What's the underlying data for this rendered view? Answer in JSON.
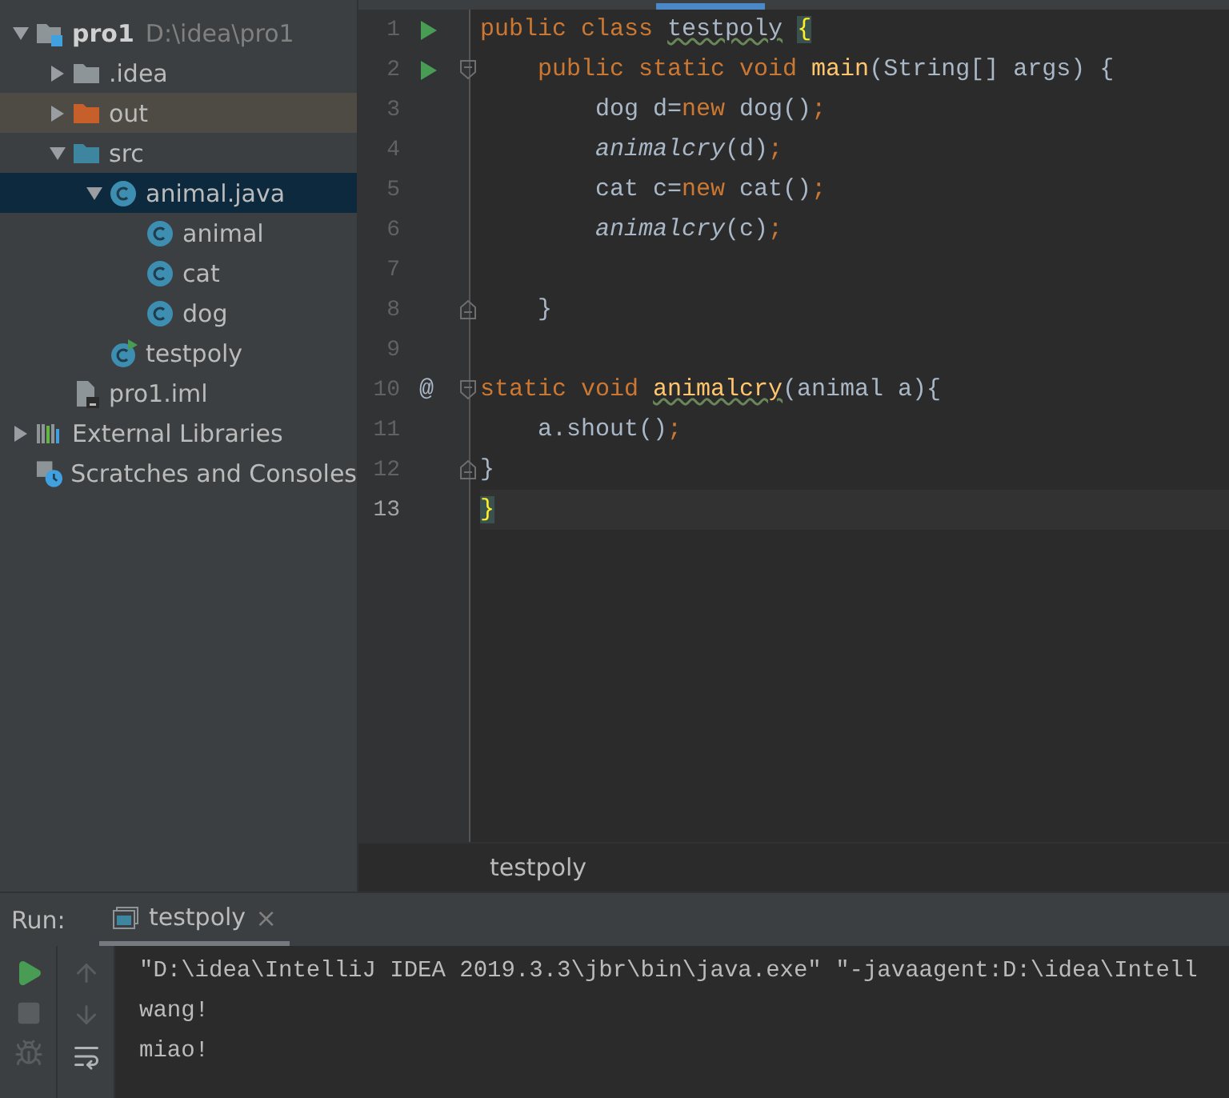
{
  "project_tree": [
    {
      "label": "pro1",
      "path": "D:\\idea\\pro1",
      "kind": "module",
      "expanded": true,
      "selected": false,
      "children": [
        {
          "label": ".idea",
          "kind": "folder",
          "expanded": false,
          "selected": false
        },
        {
          "label": "out",
          "kind": "excluded-folder",
          "expanded": false,
          "selected": false
        },
        {
          "label": "src",
          "kind": "source-folder",
          "expanded": true,
          "selected": false,
          "children": [
            {
              "label": "animal.java",
              "kind": "class",
              "expanded": true,
              "selected": true,
              "children": [
                {
                  "label": "animal",
                  "kind": "class",
                  "selected": false
                },
                {
                  "label": "cat",
                  "kind": "class",
                  "selected": false
                },
                {
                  "label": "dog",
                  "kind": "class",
                  "selected": false
                }
              ]
            },
            {
              "label": "testpoly",
              "kind": "runnable-class",
              "selected": false
            }
          ]
        },
        {
          "label": "pro1.iml",
          "kind": "file",
          "selected": false
        }
      ]
    },
    {
      "label": "External Libraries",
      "kind": "library",
      "expanded": false,
      "selected": false
    },
    {
      "label": "Scratches and Consoles",
      "kind": "scratches",
      "selected": false
    }
  ],
  "editor": {
    "lines": [
      {
        "number": "1",
        "run": true,
        "fold_start": false,
        "fold_end": false,
        "current": false,
        "tokens": [
          {
            "kind": "keyword",
            "text": "public class "
          },
          {
            "kind": "warn",
            "text": "testpoly"
          },
          {
            "kind": "match",
            "text": " {"
          }
        ]
      },
      {
        "number": "2",
        "run": true,
        "fold_start": true,
        "fold_end": false,
        "current": false,
        "tokens": [
          {
            "kind": "keyword",
            "text": "    public static void "
          },
          {
            "kind": "decl",
            "text": "main"
          },
          {
            "kind": "plain",
            "text": "(String[] args) {"
          }
        ]
      },
      {
        "number": "3",
        "run": false,
        "fold_start": false,
        "fold_end": false,
        "current": false,
        "tokens": [
          {
            "kind": "plain",
            "text": "        dog d="
          },
          {
            "kind": "keyword",
            "text": "new"
          },
          {
            "kind": "plain",
            "text": " dog()"
          },
          {
            "kind": "punct",
            "text": ";"
          }
        ]
      },
      {
        "number": "4",
        "run": false,
        "fold_start": false,
        "fold_end": false,
        "current": false,
        "tokens": [
          {
            "kind": "call",
            "text": "        animalcry"
          },
          {
            "kind": "plain",
            "text": "(d)"
          },
          {
            "kind": "punct",
            "text": ";"
          }
        ]
      },
      {
        "number": "5",
        "run": false,
        "fold_start": false,
        "fold_end": false,
        "current": false,
        "tokens": [
          {
            "kind": "plain",
            "text": "        cat c="
          },
          {
            "kind": "keyword",
            "text": "new"
          },
          {
            "kind": "plain",
            "text": " cat()"
          },
          {
            "kind": "punct",
            "text": ";"
          }
        ]
      },
      {
        "number": "6",
        "run": false,
        "fold_start": false,
        "fold_end": false,
        "current": false,
        "tokens": [
          {
            "kind": "call",
            "text": "        animalcry"
          },
          {
            "kind": "plain",
            "text": "(c)"
          },
          {
            "kind": "punct",
            "text": ";"
          }
        ]
      },
      {
        "number": "7",
        "run": false,
        "fold_start": false,
        "fold_end": false,
        "current": false
      },
      {
        "number": "8",
        "run": false,
        "fold_start": false,
        "fold_end": true,
        "current": false,
        "tokens": [
          {
            "kind": "plain",
            "text": "    }"
          }
        ]
      },
      {
        "number": "9",
        "run": false,
        "fold_start": false,
        "fold_end": false,
        "current": false
      },
      {
        "number": "10",
        "gutter_mark": "@",
        "run": false,
        "fold_start": true,
        "fold_end": false,
        "current": false,
        "tokens": [
          {
            "kind": "keyword",
            "text": "static void "
          },
          {
            "kind": "decl-warn",
            "text": "animalcry"
          },
          {
            "kind": "plain",
            "text": "(animal a){"
          }
        ]
      },
      {
        "number": "11",
        "run": false,
        "fold_start": false,
        "fold_end": false,
        "current": false,
        "tokens": [
          {
            "kind": "plain",
            "text": "    a.shout()"
          },
          {
            "kind": "punct",
            "text": ";"
          }
        ]
      },
      {
        "number": "12",
        "run": false,
        "fold_start": false,
        "fold_end": true,
        "current": false,
        "tokens": [
          {
            "kind": "plain",
            "text": "}"
          }
        ]
      },
      {
        "number": "13",
        "run": false,
        "fold_start": false,
        "fold_end": false,
        "current": true,
        "tokens": [
          {
            "kind": "match",
            "text": "}"
          }
        ]
      }
    ],
    "breadcrumb": "testpoly"
  },
  "run_panel": {
    "label": "Run:",
    "tabs": [
      {
        "label": "testpoly",
        "close": "×",
        "selected": true
      }
    ],
    "output": [
      "\"D:\\idea\\IntelliJ IDEA 2019.3.3\\jbr\\bin\\java.exe\" \"-javaagent:D:\\idea\\Intell",
      "wang!",
      "miao!"
    ]
  }
}
